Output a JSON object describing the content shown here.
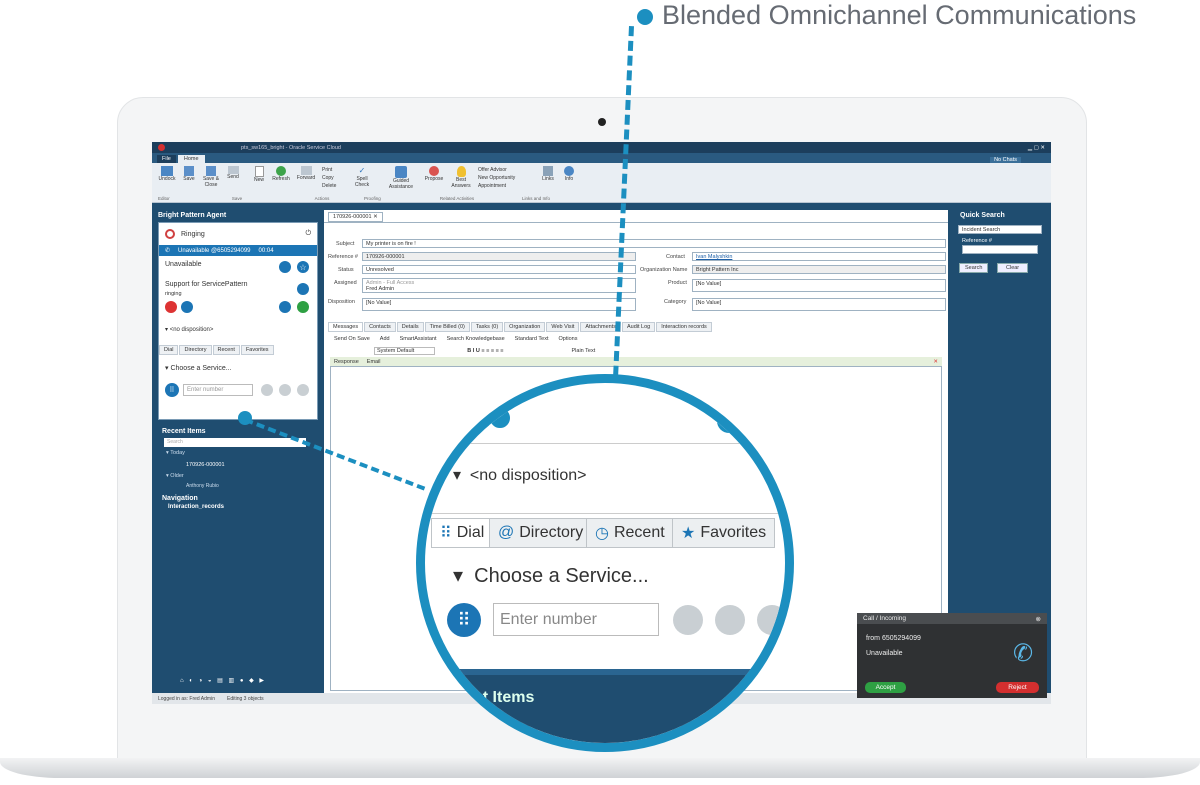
{
  "headline": "Blended Omnichannel Communications",
  "app": {
    "title": "pts_sw165_bright - Oracle Service Cloud",
    "file_tab": "File",
    "home_tab": "Home",
    "chat_status": "No Chats"
  },
  "ribbon": {
    "buttons": [
      "Undock",
      "Save",
      "Save & Close",
      "Send",
      "New",
      "Refresh",
      "Forward",
      "Print",
      "Copy",
      "Delete",
      "Spell Check",
      "Guided Assistance",
      "Propose",
      "Best Answers",
      "Offer Advisor",
      "New Opportunity",
      "Appointment",
      "Links",
      "Info"
    ],
    "groups": [
      "Editor",
      "Save",
      "Actions",
      "Proofing",
      "Related Activities",
      "Links and Info"
    ]
  },
  "agent": {
    "panel_title": "Bright Pattern Agent",
    "ringing": "Ringing",
    "status_bar": "Unavailable @6505294099",
    "timer": "00:04",
    "state": "Unavailable",
    "service": "Support for ServicePattern",
    "service_state": "ringing",
    "disposition": "<no disposition>",
    "tabs": [
      "Dial",
      "Directory",
      "Recent",
      "Favorites"
    ],
    "choose_service": "Choose a Service...",
    "number_placeholder": "Enter number"
  },
  "recent": {
    "title": "Recent Items",
    "search": "Search",
    "today": "Today",
    "item": "170926-000001",
    "older": "Older",
    "older_item": "Anthony Rubio"
  },
  "nav": {
    "title": "Navigation",
    "item": "Interaction_records"
  },
  "status": {
    "logged_in": "Logged in as: Fred Admin",
    "editing": "Editing 3 objects"
  },
  "incident": {
    "tab": "170926-000001",
    "subject_label": "Subject",
    "subject": "My printer is on fire !",
    "reference_label": "Reference #",
    "reference": "170926-000001",
    "contact_label": "Contact",
    "contact": "Ivan Malyshkin",
    "status_label": "Status",
    "status": "Unresolved",
    "org_label": "Organization Name",
    "org": "Bright Pattern Inc",
    "assigned_label": "Assigned",
    "assigned_group": "Admin - Full Access",
    "assigned_user": "Fred Admin",
    "product_label": "Product",
    "product": "[No Value]",
    "disposition_label": "Disposition",
    "disposition": "[No Value]",
    "category_label": "Category",
    "category": "[No Value]",
    "tabs": [
      "Messages",
      "Contacts",
      "Details",
      "Time Billed (0)",
      "Tasks (0)",
      "Organization",
      "Web Visit",
      "Attachments",
      "Audit Log",
      "Interaction records"
    ],
    "send_on_save": "Send On Save",
    "add": "Add",
    "smart_assistant": "SmartAssistant",
    "search_kb": "Search Knowledgebase",
    "standard_text": "Standard Text",
    "options": "Options",
    "font": "System Default",
    "plain_text": "Plain Text",
    "response": "Response",
    "email": "Email"
  },
  "quick_search": {
    "title": "Quick Search",
    "type": "Incident Search",
    "ref_label": "Reference #",
    "search": "Search",
    "clear": "Clear"
  },
  "call": {
    "title": "Call / Incoming",
    "from": "from 6505294099",
    "state": "Unavailable",
    "accept": "Accept",
    "reject": "Reject"
  },
  "magnified": {
    "disposition": "<no disposition>",
    "tabs": [
      "Dial",
      "Directory",
      "Recent",
      "Favorites"
    ],
    "choose_service": "Choose a Service...",
    "number_placeholder": "Enter number",
    "footer": "nt Items"
  },
  "colors": {
    "accent": "#1c8fc0",
    "accept": "#2ea043",
    "reject": "#d32f2f",
    "brand_blue": "#1f4d70"
  }
}
